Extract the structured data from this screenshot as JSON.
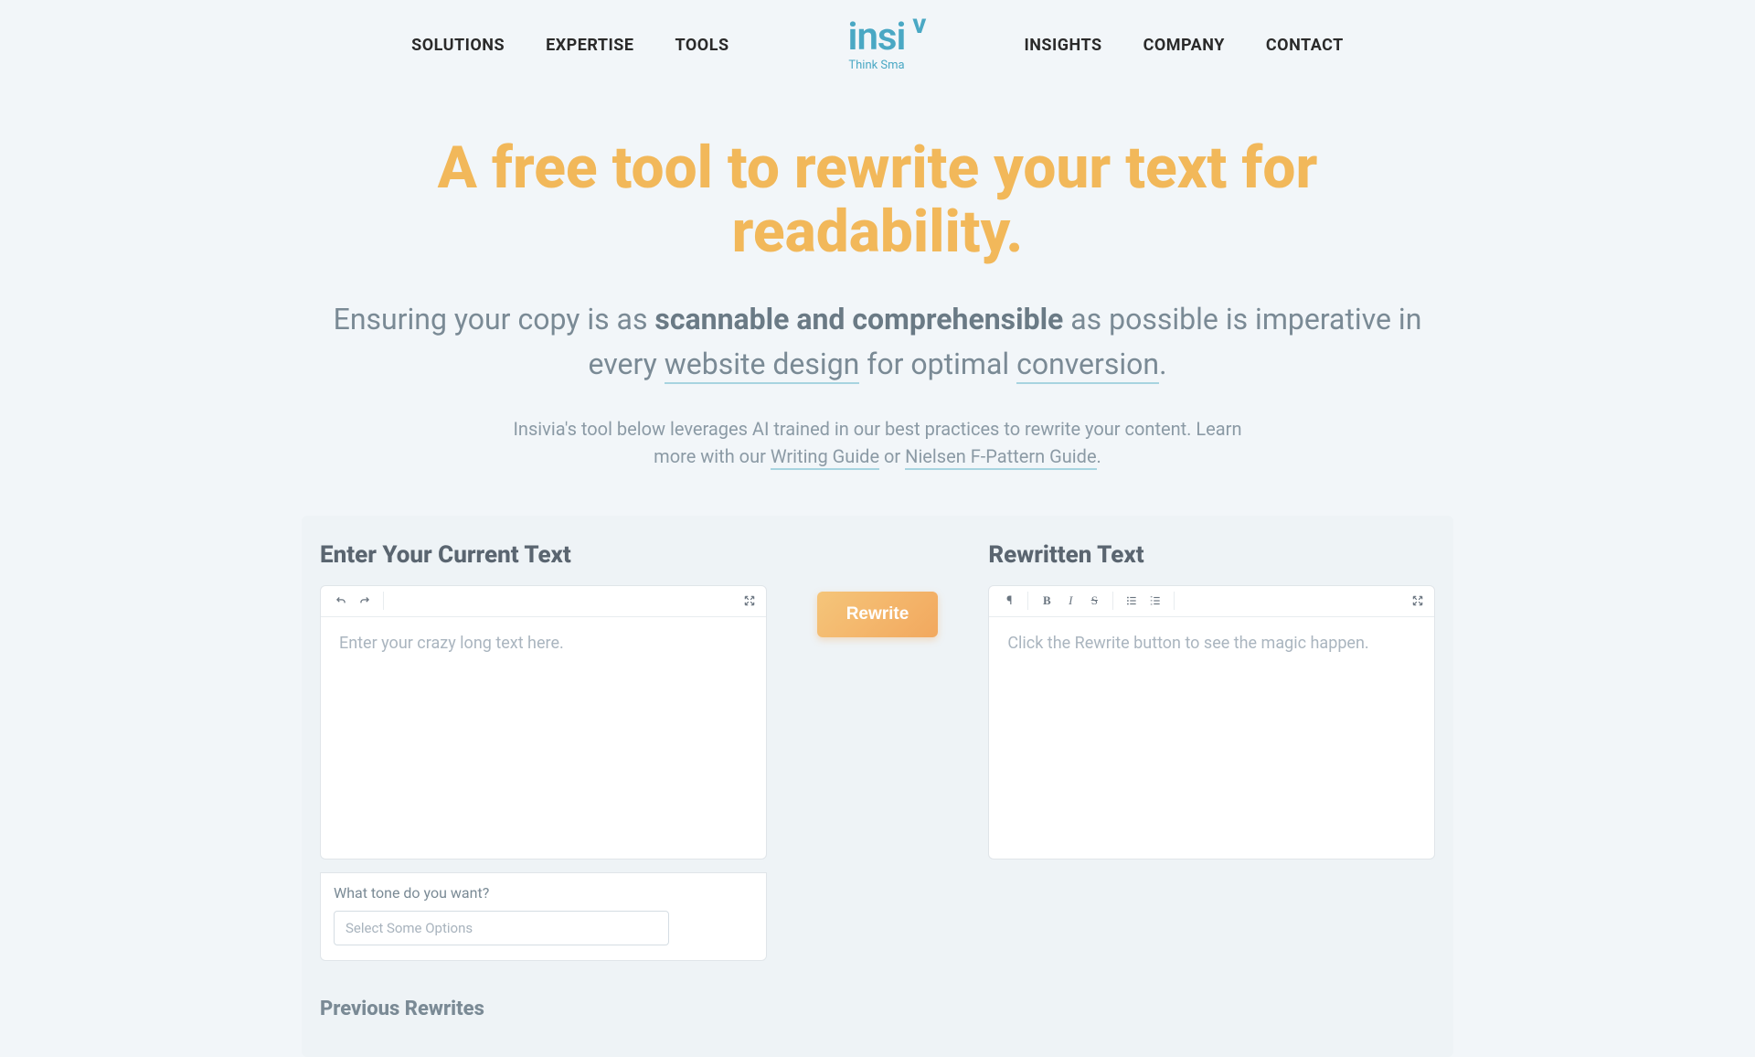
{
  "nav": {
    "left": [
      "SOLUTIONS",
      "EXPERTISE",
      "TOOLS"
    ],
    "right": [
      "INSIGHTS",
      "COMPANY",
      "CONTACT"
    ]
  },
  "logo": {
    "text": "insi",
    "superscript": "v",
    "tagline": "Think Sma"
  },
  "hero": {
    "title": "A free tool to rewrite your text for readability.",
    "subtitle_pre": "Ensuring your copy is as ",
    "subtitle_bold": "scannable and comprehensible",
    "subtitle_mid1": " as possible is imperative in every ",
    "subtitle_link1": "website design",
    "subtitle_mid2": " for optimal ",
    "subtitle_link2": "conversion",
    "subtitle_end": ".",
    "description_pre": "Insivia's tool below leverages AI trained in our best practices to rewrite your content. Learn more with our ",
    "description_link1": "Writing Guide",
    "description_mid": " or ",
    "description_link2": "Nielsen F-Pattern Guide",
    "description_end": "."
  },
  "tool": {
    "input_title": "Enter Your Current Text",
    "input_placeholder": "Enter your crazy long text here.",
    "tone_label": "What tone do you want?",
    "tone_placeholder": "Select Some Options",
    "rewrite_label": "Rewrite",
    "output_title": "Rewritten Text",
    "output_placeholder": "Click the Rewrite button to see the magic happen.",
    "previous_title": "Previous Rewrites"
  },
  "toolbar": {
    "paragraph": "¶",
    "bold": "B",
    "italic": "I",
    "strike": "S"
  }
}
